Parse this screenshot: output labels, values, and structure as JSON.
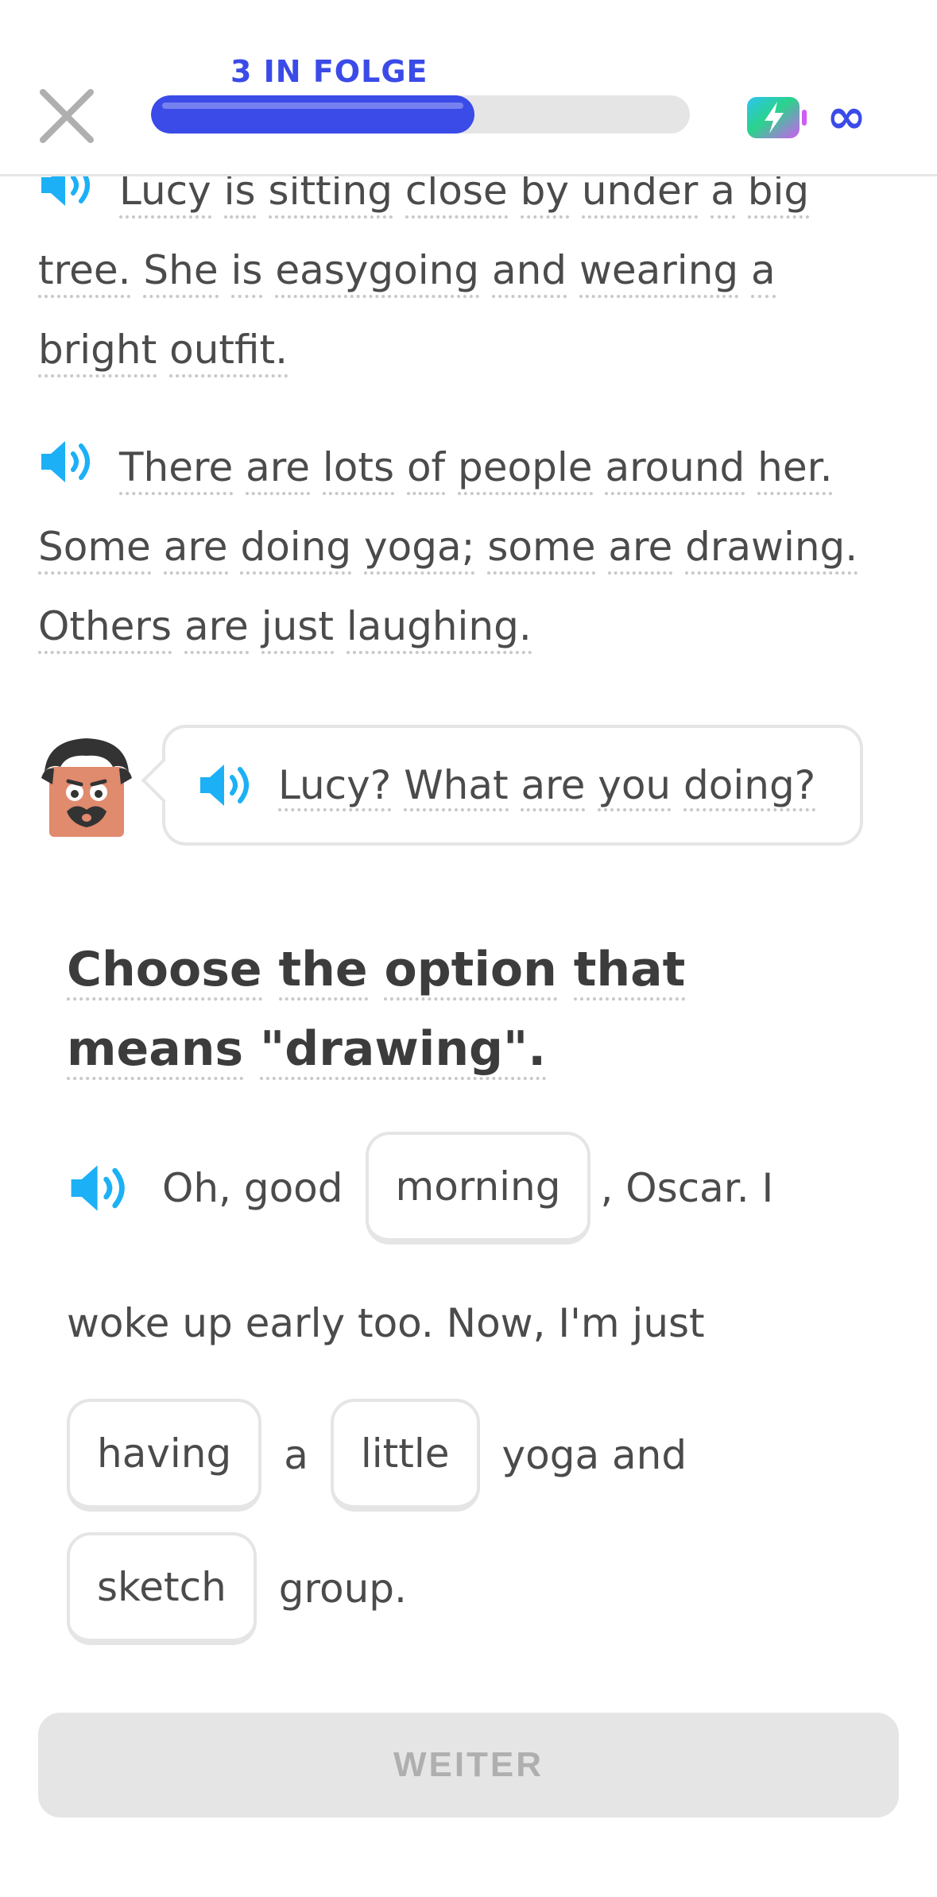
{
  "header": {
    "streak_label": "3 IN FOLGE",
    "progress": 0.6,
    "hearts_label": "∞",
    "accent_color": "#3a4be8"
  },
  "story": {
    "paragraph1": {
      "words": [
        "Lucy",
        "is",
        "sitting",
        "close",
        "by",
        "under",
        "a",
        "big",
        "tree.",
        "She",
        "is",
        "easygoing",
        "and",
        "wearing",
        "a",
        "bright",
        "outfit."
      ]
    },
    "paragraph2": {
      "words": [
        "There",
        "are",
        "lots",
        "of",
        "people",
        "around",
        "her.",
        "Some",
        "are",
        "doing",
        "yoga;",
        "some",
        "are",
        "drawing.",
        "Others",
        "are",
        "just",
        "laughing."
      ]
    },
    "dialogue": {
      "words": [
        "Lucy?",
        "What",
        "are",
        "you",
        "doing?"
      ]
    }
  },
  "question": {
    "words": [
      "Choose",
      "the",
      "option",
      "that",
      "means",
      "\"drawing\"."
    ]
  },
  "sentence": {
    "text1": "Oh, good",
    "option1": "morning",
    "text2": ", Oscar. I",
    "text3": "woke up early too. Now, I'm just",
    "option2": "having",
    "text4": "a",
    "option3": "little",
    "text5": "yoga and",
    "option4": "sketch",
    "text6": "group."
  },
  "footer": {
    "continue_label": "WEITER"
  }
}
